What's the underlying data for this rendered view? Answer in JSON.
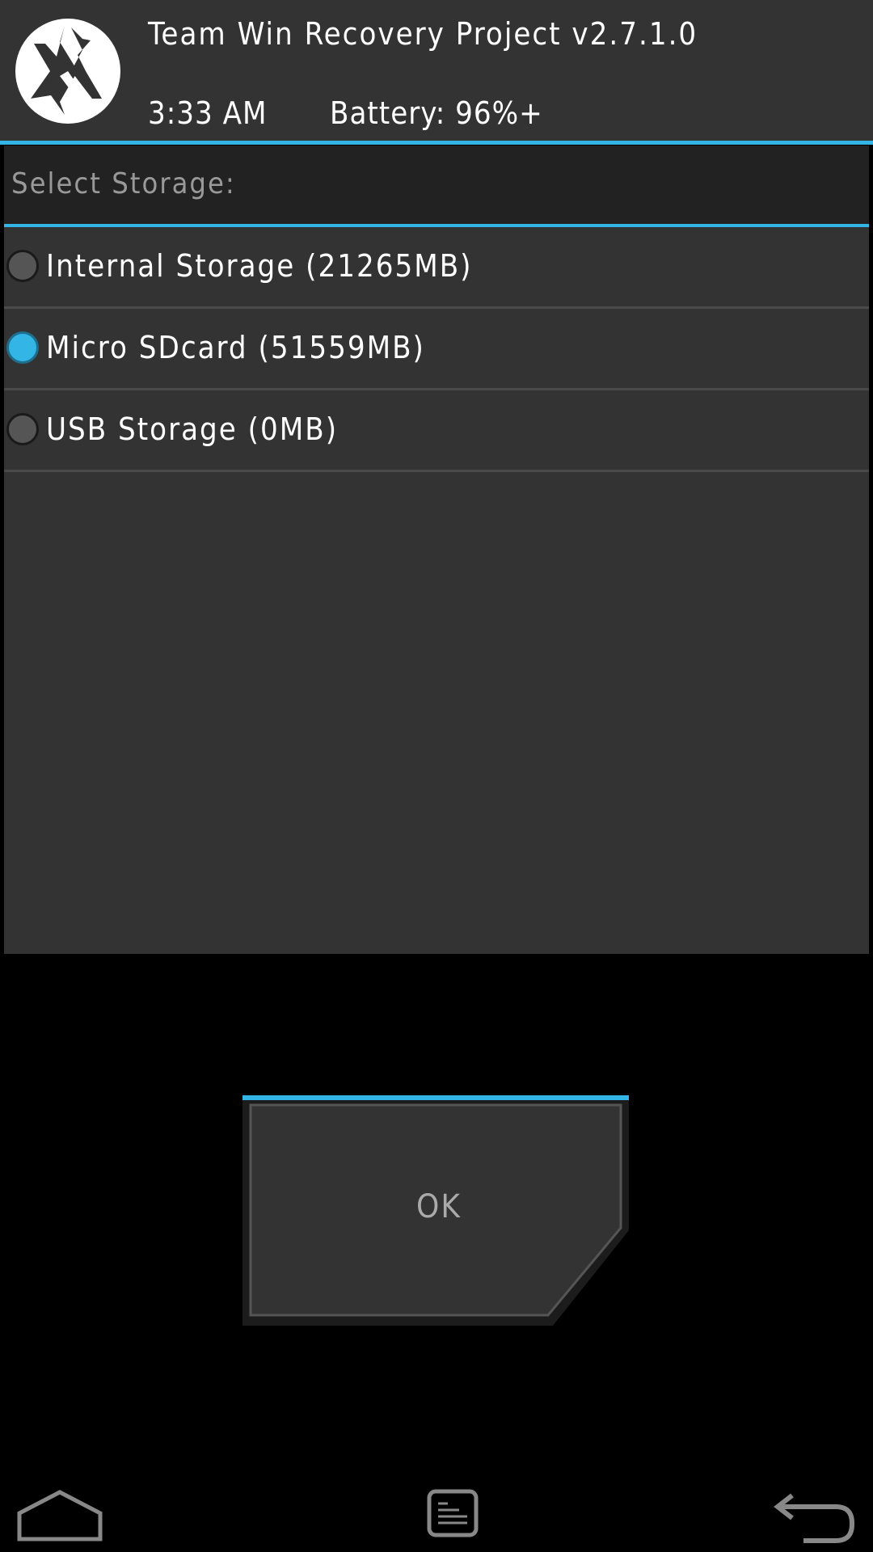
{
  "header": {
    "title": "Team Win Recovery Project  v2.7.1.0",
    "time": "3:33 AM",
    "battery": "Battery: 96%+"
  },
  "storage": {
    "title": "Select Storage:",
    "options": [
      {
        "label": "Internal Storage (21265MB)",
        "selected": false
      },
      {
        "label": "Micro SDcard (51559MB)",
        "selected": true
      },
      {
        "label": "USB Storage (0MB)",
        "selected": false
      }
    ]
  },
  "ok_button": {
    "label": "OK"
  },
  "colors": {
    "accent": "#33b5e5",
    "panel": "#333333",
    "header": "#333333",
    "background": "#000000"
  },
  "icons": {
    "logo": "twrp-logo-icon",
    "home": "home-icon",
    "console": "console-icon",
    "back": "back-icon"
  }
}
